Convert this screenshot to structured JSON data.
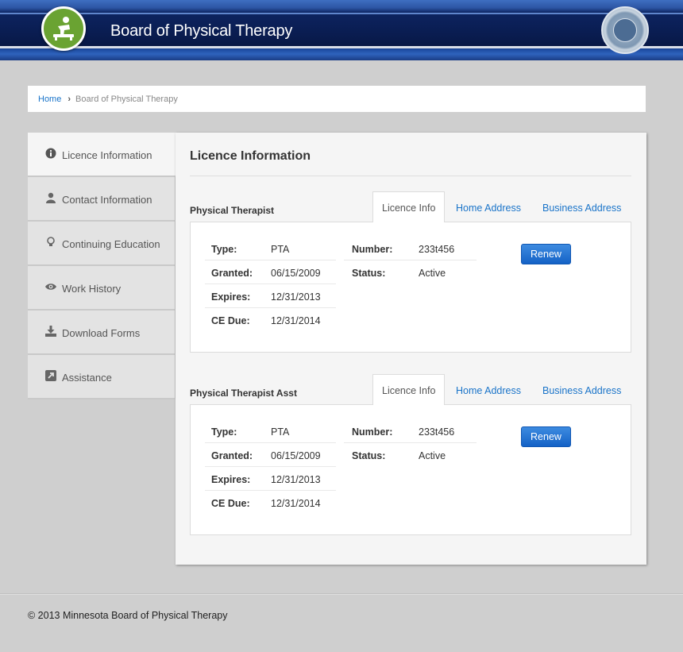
{
  "header": {
    "site_title": "Board of Physical Therapy",
    "logo_icon": "physical-therapy-logo-icon",
    "seal_icon": "state-seal-icon"
  },
  "breadcrumb": {
    "home": "Home",
    "separator": "›",
    "current": "Board of Physical Therapy"
  },
  "sidebar": {
    "items": [
      {
        "label": "Licence Information",
        "icon": "info-icon",
        "active": true
      },
      {
        "label": "Contact Information",
        "icon": "user-icon",
        "active": false
      },
      {
        "label": "Continuing Education",
        "icon": "lightbulb-icon",
        "active": false
      },
      {
        "label": "Work History",
        "icon": "eye-icon",
        "active": false
      },
      {
        "label": "Download Forms",
        "icon": "download-icon",
        "active": false
      },
      {
        "label": "Assistance",
        "icon": "external-link-icon",
        "active": false
      }
    ]
  },
  "main": {
    "title": "Licence Information",
    "sections": [
      {
        "title": "Physical Therapist",
        "tabs": [
          "Licence Info",
          "Home Address",
          "Business Address"
        ],
        "left_fields": [
          {
            "key": "Type:",
            "value": "PTA"
          },
          {
            "key": "Granted:",
            "value": "06/15/2009"
          },
          {
            "key": "Expires:",
            "value": "12/31/2013"
          },
          {
            "key": "CE Due:",
            "value": "12/31/2014"
          }
        ],
        "right_fields": [
          {
            "key": "Number:",
            "value": "233t456"
          },
          {
            "key": "Status:",
            "value": "Active"
          }
        ],
        "button": "Renew"
      },
      {
        "title": "Physical Therapist Asst",
        "tabs": [
          "Licence Info",
          "Home Address",
          "Business Address"
        ],
        "left_fields": [
          {
            "key": "Type:",
            "value": "PTA"
          },
          {
            "key": "Granted:",
            "value": "06/15/2009"
          },
          {
            "key": "Expires:",
            "value": "12/31/2013"
          },
          {
            "key": "CE Due:",
            "value": "12/31/2014"
          }
        ],
        "right_fields": [
          {
            "key": "Number:",
            "value": "233t456"
          },
          {
            "key": "Status:",
            "value": "Active"
          }
        ],
        "button": "Renew"
      }
    ]
  },
  "footer": {
    "copyright": "© 2013 Minnesota Board of Physical Therapy"
  },
  "colors": {
    "link": "#1a74c9",
    "header_navy": "#0a1d52",
    "logo_green": "#6aa332",
    "button_blue": "#1462c6"
  }
}
